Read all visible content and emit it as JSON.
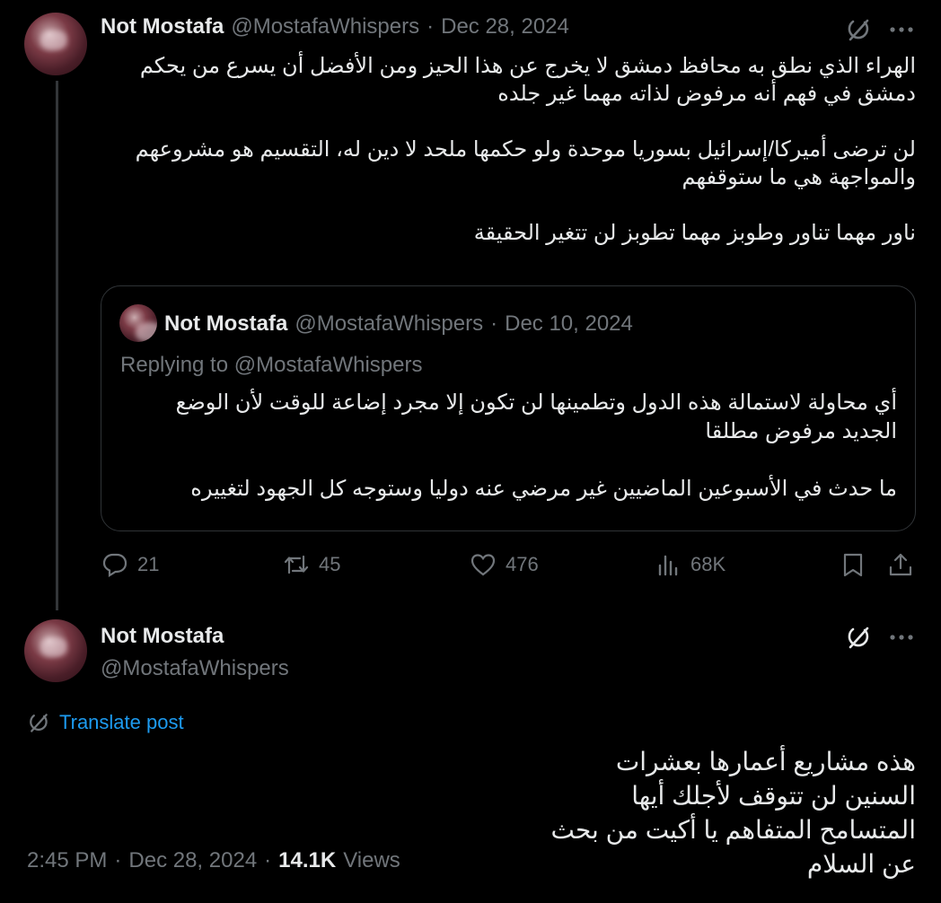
{
  "parent_tweet": {
    "author_name": "Not Mostafa",
    "handle": "@MostafaWhispers",
    "separator": "·",
    "date": "Dec 28, 2024",
    "body": "الهراء الذي نطق به محافظ دمشق لا يخرج عن هذا الحيز ومن الأفضل أن يسرع من يحكم دمشق في فهم أنه مرفوض لذاته مهما غير جلده\n\nلن ترضى أميركا/إسرائيل بسوريا موحدة ولو حكمها ملحد لا دين له، التقسيم هو مشروعهم والمواجهة هي ما ستوقفهم\n\nناور مهما تناور وطوبز مهما تطوبز لن تتغير الحقيقة",
    "quoted": {
      "author_name": "Not Mostafa",
      "handle": "@MostafaWhispers",
      "separator": "·",
      "date": "Dec 10, 2024",
      "replying_to": "Replying to @MostafaWhispers",
      "body": "أي محاولة لاستمالة هذه الدول وتطمينها لن تكون إلا مجرد إضاعة للوقت لأن الوضع الجديد مرفوض مطلقا\n\nما حدث في الأسبوعين الماضيين غير مرضي عنه دوليا وستوجه كل الجهود لتغييره"
    },
    "actions": {
      "replies": "21",
      "reposts": "45",
      "likes": "476",
      "views": "68K"
    }
  },
  "main_tweet": {
    "author_name": "Not Mostafa",
    "handle": "@MostafaWhispers",
    "translate_label": "Translate post",
    "body": "هذه مشاريع أعمارها بعشرات السنين لن تتوقف لأجلك أيها المتسامح المتفاهم يا أكيت من بحث عن السلام",
    "time": "2:45 PM",
    "separator": "·",
    "date": "Dec 28, 2024",
    "views_count": "14.1K",
    "views_label": "Views"
  },
  "colors": {
    "background": "#000000",
    "text": "#e7e9ea",
    "muted": "#71767b",
    "link": "#1d9bf0",
    "border": "#2f3336"
  },
  "icons": [
    "grok-icon",
    "more-icon",
    "reply-icon",
    "repost-icon",
    "like-icon",
    "views-icon",
    "bookmark-icon",
    "share-icon",
    "translate-icon"
  ]
}
